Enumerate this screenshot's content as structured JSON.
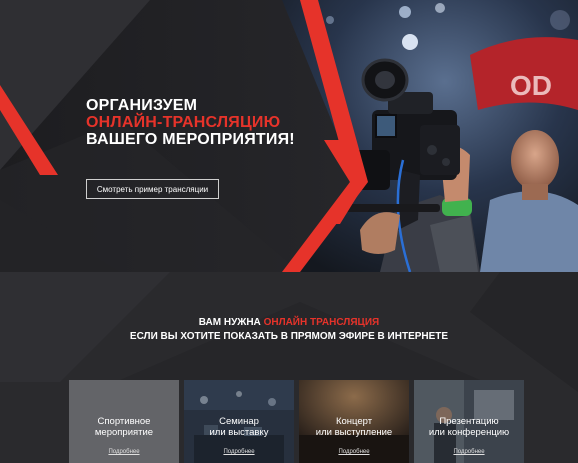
{
  "hero": {
    "title_line1": "ОРГАНИЗУЕМ",
    "title_line2": "ОНЛАЙН-ТРАНСЛЯЦИЮ",
    "title_line3": "ВАШЕГО МЕРОПРИЯТИЯ!",
    "button_label": "Смотреть пример трансляции"
  },
  "intro": {
    "line1_prefix": "ВАМ НУЖНА",
    "line1_accent": "ОНЛАЙН ТРАНСЛЯЦИЯ",
    "line2": "ЕСЛИ ВЫ ХОТИТЕ ПОКАЗАТЬ В ПРЯМОМ ЭФИРЕ В ИНТЕРНЕТЕ"
  },
  "cards": [
    {
      "line1": "Спортивное",
      "line2": "мероприятие",
      "more": "Подробнее"
    },
    {
      "line1": "Семинар",
      "line2": "или выставку",
      "more": "Подробнее"
    },
    {
      "line1": "Концерт",
      "line2": "или выступление",
      "more": "Подробнее"
    },
    {
      "line1": "Презентацию",
      "line2": "или конференцию",
      "more": "Подробнее"
    }
  ],
  "colors": {
    "accent": "#e6332a",
    "background": "#232326"
  }
}
